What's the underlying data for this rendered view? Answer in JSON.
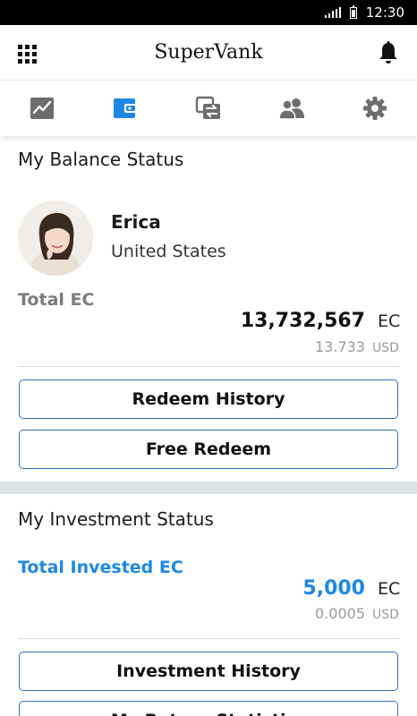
{
  "status_bar": {
    "time": "12:30"
  },
  "header": {
    "app_title": "SuperVank"
  },
  "tabs": [
    {
      "icon": "chart-icon",
      "active": false
    },
    {
      "icon": "wallet-icon",
      "active": true
    },
    {
      "icon": "exchange-icon",
      "active": false
    },
    {
      "icon": "people-icon",
      "active": false
    },
    {
      "icon": "gear-icon",
      "active": false
    }
  ],
  "balance": {
    "title": "My Balance Status",
    "profile": {
      "name": "Erica",
      "country": "United States"
    },
    "total_label": "Total EC",
    "amount": "13,732,567",
    "amount_unit": "EC",
    "usd_amount": "13.733",
    "usd_unit": "USD",
    "redeem_history_label": "Redeem History",
    "free_redeem_label": "Free Redeem"
  },
  "investment": {
    "title": "My Investment Status",
    "total_label": "Total Invested EC",
    "amount": "5,000",
    "amount_unit": "EC",
    "usd_amount": "0.0005",
    "usd_unit": "USD",
    "investment_history_label": "Investment History",
    "next_button_label": "My Return Statistics"
  },
  "colors": {
    "accent": "#1e88e5",
    "button_border": "#2f6fbf",
    "muted": "#7b7b7b",
    "section_gap": "#dfe3e6"
  }
}
